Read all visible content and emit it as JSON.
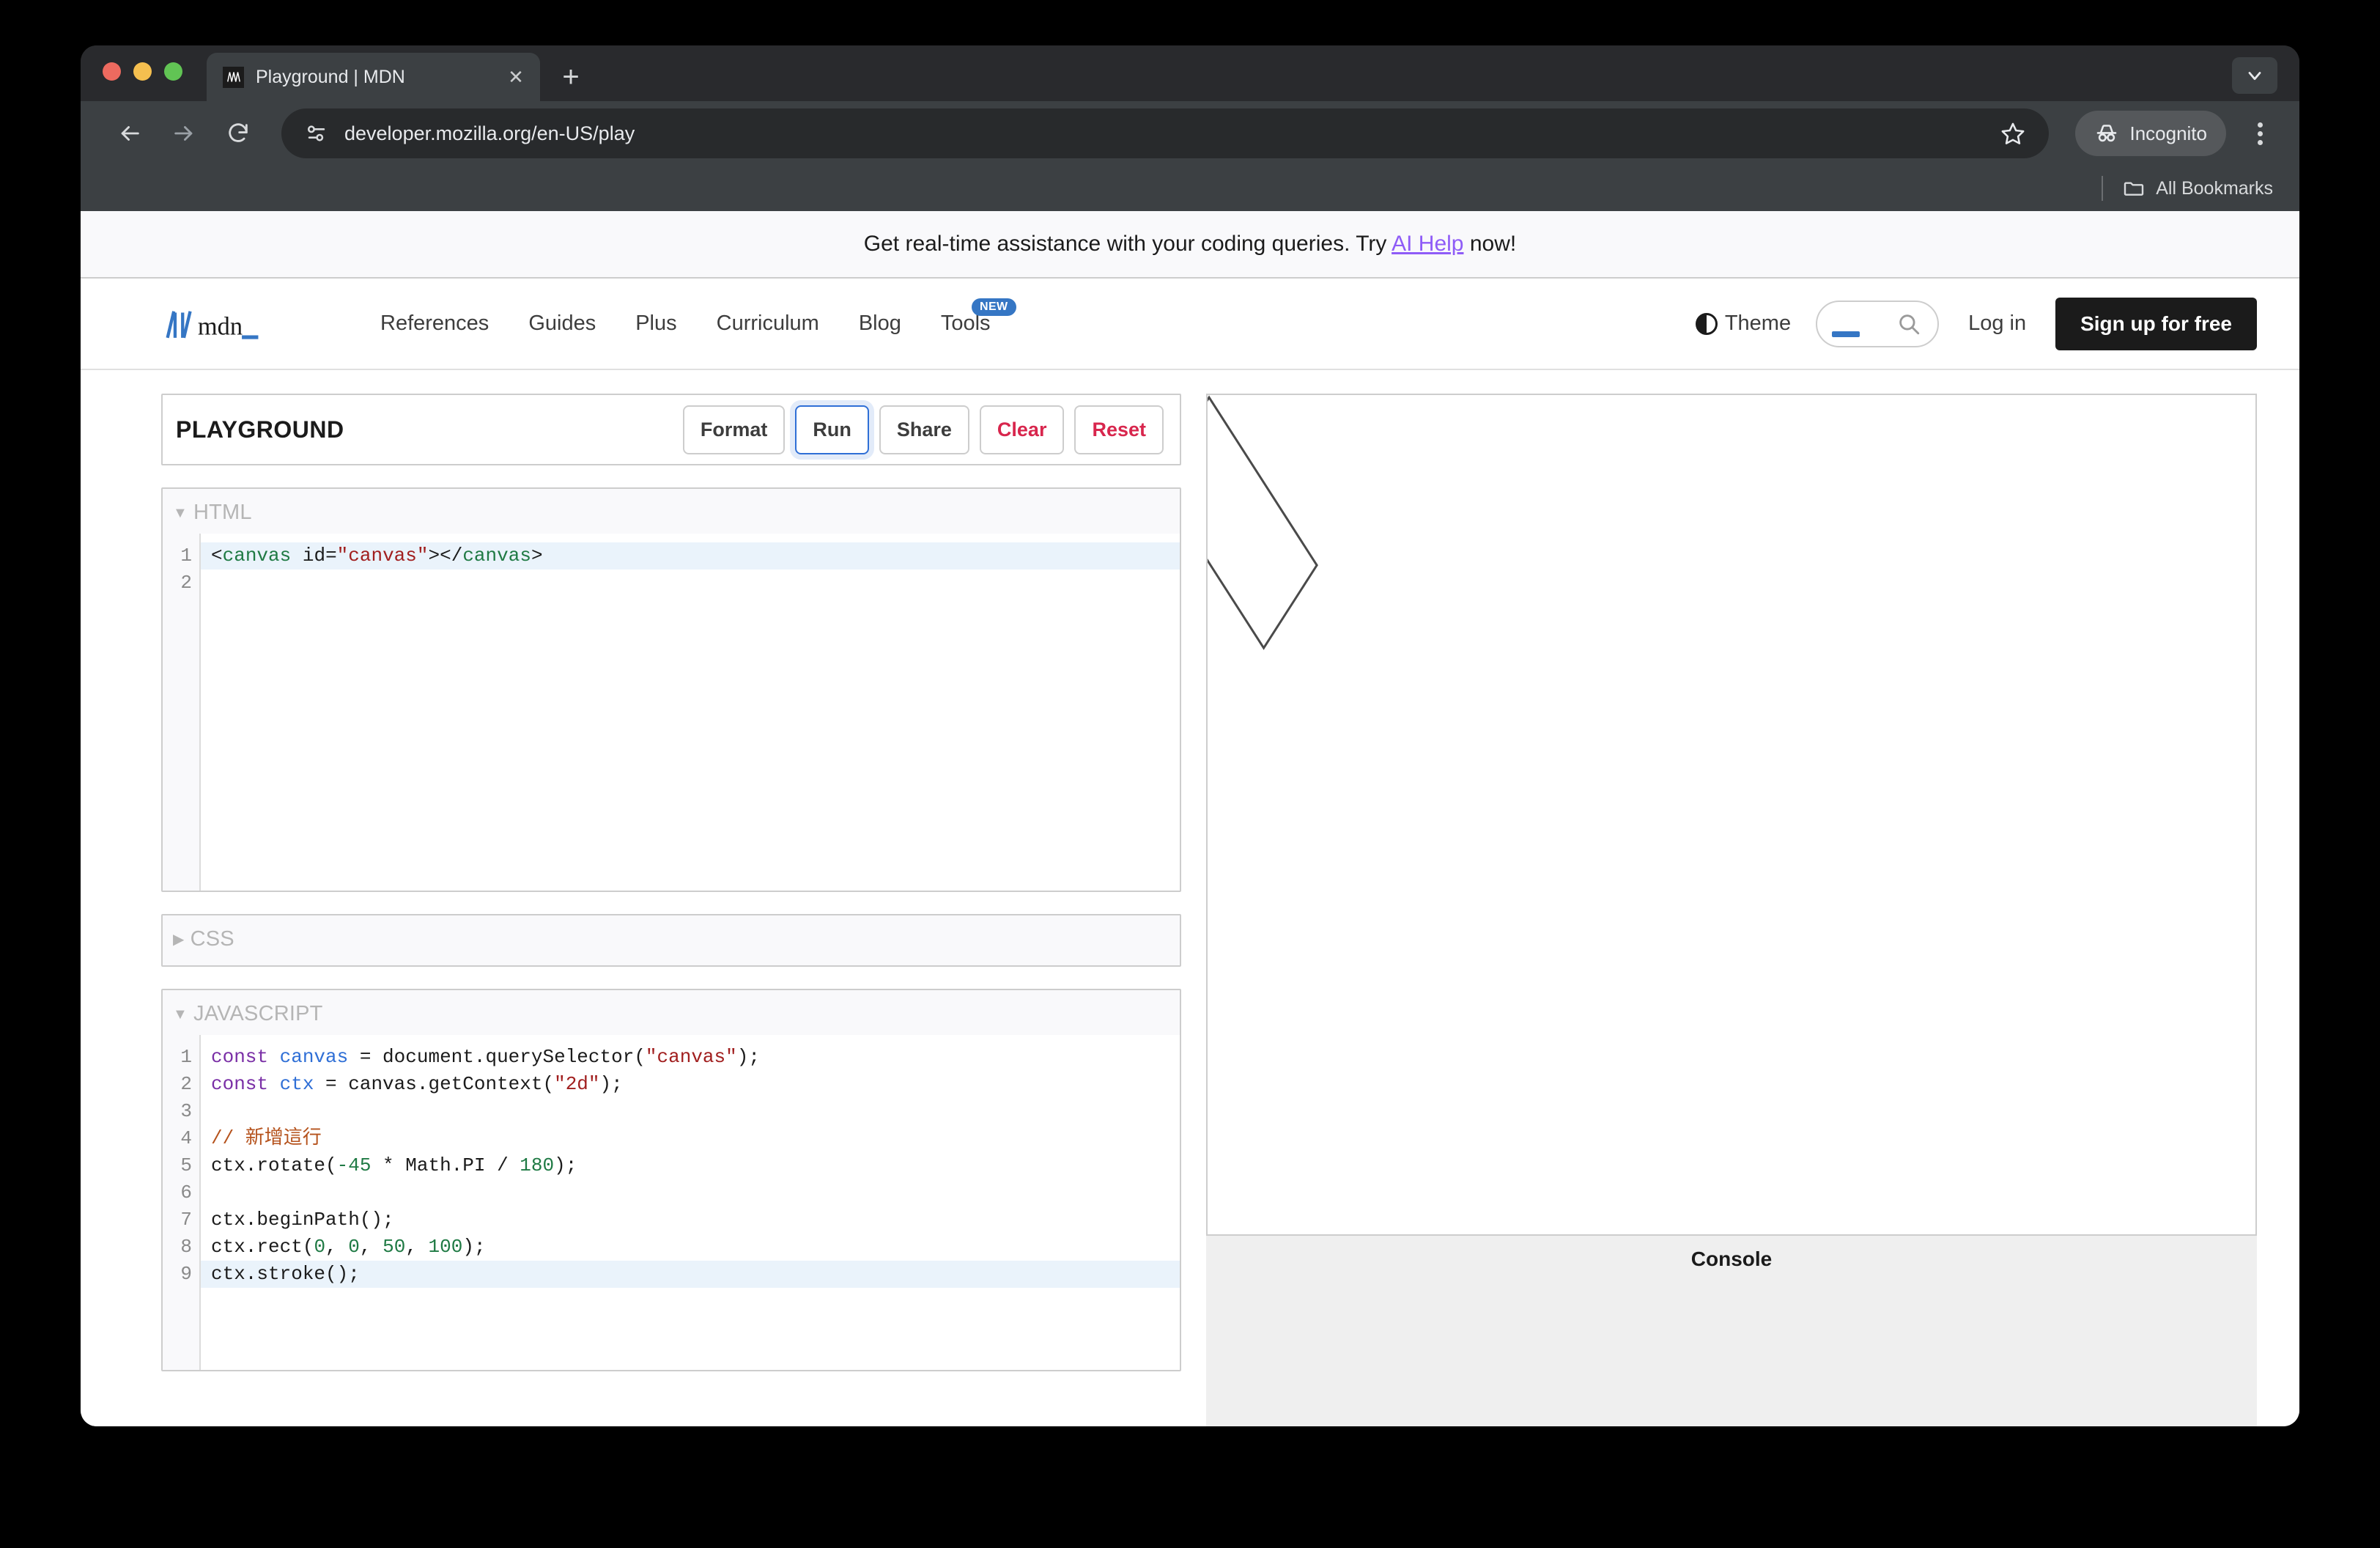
{
  "browser": {
    "tab": {
      "title": "Playground | MDN",
      "favicon_icon": "mdn-favicon",
      "close_icon": "close-icon"
    },
    "new_tab_icon": "plus-icon",
    "tabstrip_chevron_icon": "chevron-down-icon",
    "back_icon": "arrow-left-icon",
    "forward_icon": "arrow-right-icon",
    "reload_icon": "reload-icon",
    "site_info_icon": "site-settings-icon",
    "url": "developer.mozilla.org/en-US/play",
    "bookmark_star_icon": "star-icon",
    "incognito": {
      "label": "Incognito",
      "icon": "incognito-icon"
    },
    "menu_icon": "kebab-menu-icon",
    "bookmarks": {
      "label": "All Bookmarks",
      "icon": "folder-icon"
    }
  },
  "banner": {
    "text_before": "Get real-time assistance with your coding queries. Try ",
    "link": "AI Help",
    "text_after": " now!",
    "link_color": "#8f5cf7"
  },
  "header": {
    "logo_alt": "mdn",
    "nav": [
      {
        "label": "References"
      },
      {
        "label": "Guides"
      },
      {
        "label": "Plus"
      },
      {
        "label": "Curriculum"
      },
      {
        "label": "Blog"
      },
      {
        "label": "Tools",
        "badge": "NEW"
      }
    ],
    "theme_label": "Theme",
    "theme_icon": "half-circle-icon",
    "search_icon": "search-icon",
    "login_label": "Log in",
    "signup_label": "Sign up for free"
  },
  "playground": {
    "title": "PLAYGROUND",
    "buttons": [
      {
        "label": "Format",
        "style": "default"
      },
      {
        "label": "Run",
        "style": "active"
      },
      {
        "label": "Share",
        "style": "default"
      },
      {
        "label": "Clear",
        "style": "danger"
      },
      {
        "label": "Reset",
        "style": "danger"
      }
    ],
    "editors": {
      "html": {
        "label": "HTML",
        "expanded": true,
        "caret": "▼",
        "line_numbers": [
          "1",
          "2"
        ],
        "code_plain": "<canvas id=\"canvas\"></canvas>"
      },
      "css": {
        "label": "CSS",
        "expanded": false,
        "caret": "▶"
      },
      "javascript": {
        "label": "JAVASCRIPT",
        "expanded": true,
        "caret": "▼",
        "line_numbers": [
          "1",
          "2",
          "3",
          "4",
          "5",
          "6",
          "7",
          "8",
          "9"
        ],
        "code_plain": "const canvas = document.querySelector(\"canvas\");\nconst ctx = canvas.getContext(\"2d\");\n\n// 新增這行\nctx.rotate(-45 * Math.PI / 180);\n\nctx.beginPath();\nctx.rect(0, 0, 50, 100);\nctx.stroke();",
        "lines": [
          {
            "n": "1",
            "text": "const canvas = document.querySelector(\"canvas\");"
          },
          {
            "n": "2",
            "text": "const ctx = canvas.getContext(\"2d\");"
          },
          {
            "n": "3",
            "text": ""
          },
          {
            "n": "4",
            "text": "// 新增這行"
          },
          {
            "n": "5",
            "text": "ctx.rotate(-45 * Math.PI / 180);"
          },
          {
            "n": "6",
            "text": ""
          },
          {
            "n": "7",
            "text": "ctx.beginPath();"
          },
          {
            "n": "8",
            "text": "ctx.rect(0, 0, 50, 100);"
          },
          {
            "n": "9",
            "text": "ctx.stroke();"
          }
        ]
      }
    },
    "output": {
      "shape": "rotated-rectangle-outline",
      "stroke_color": "#4a4a4a"
    },
    "console": {
      "title": "Console",
      "messages": []
    }
  }
}
